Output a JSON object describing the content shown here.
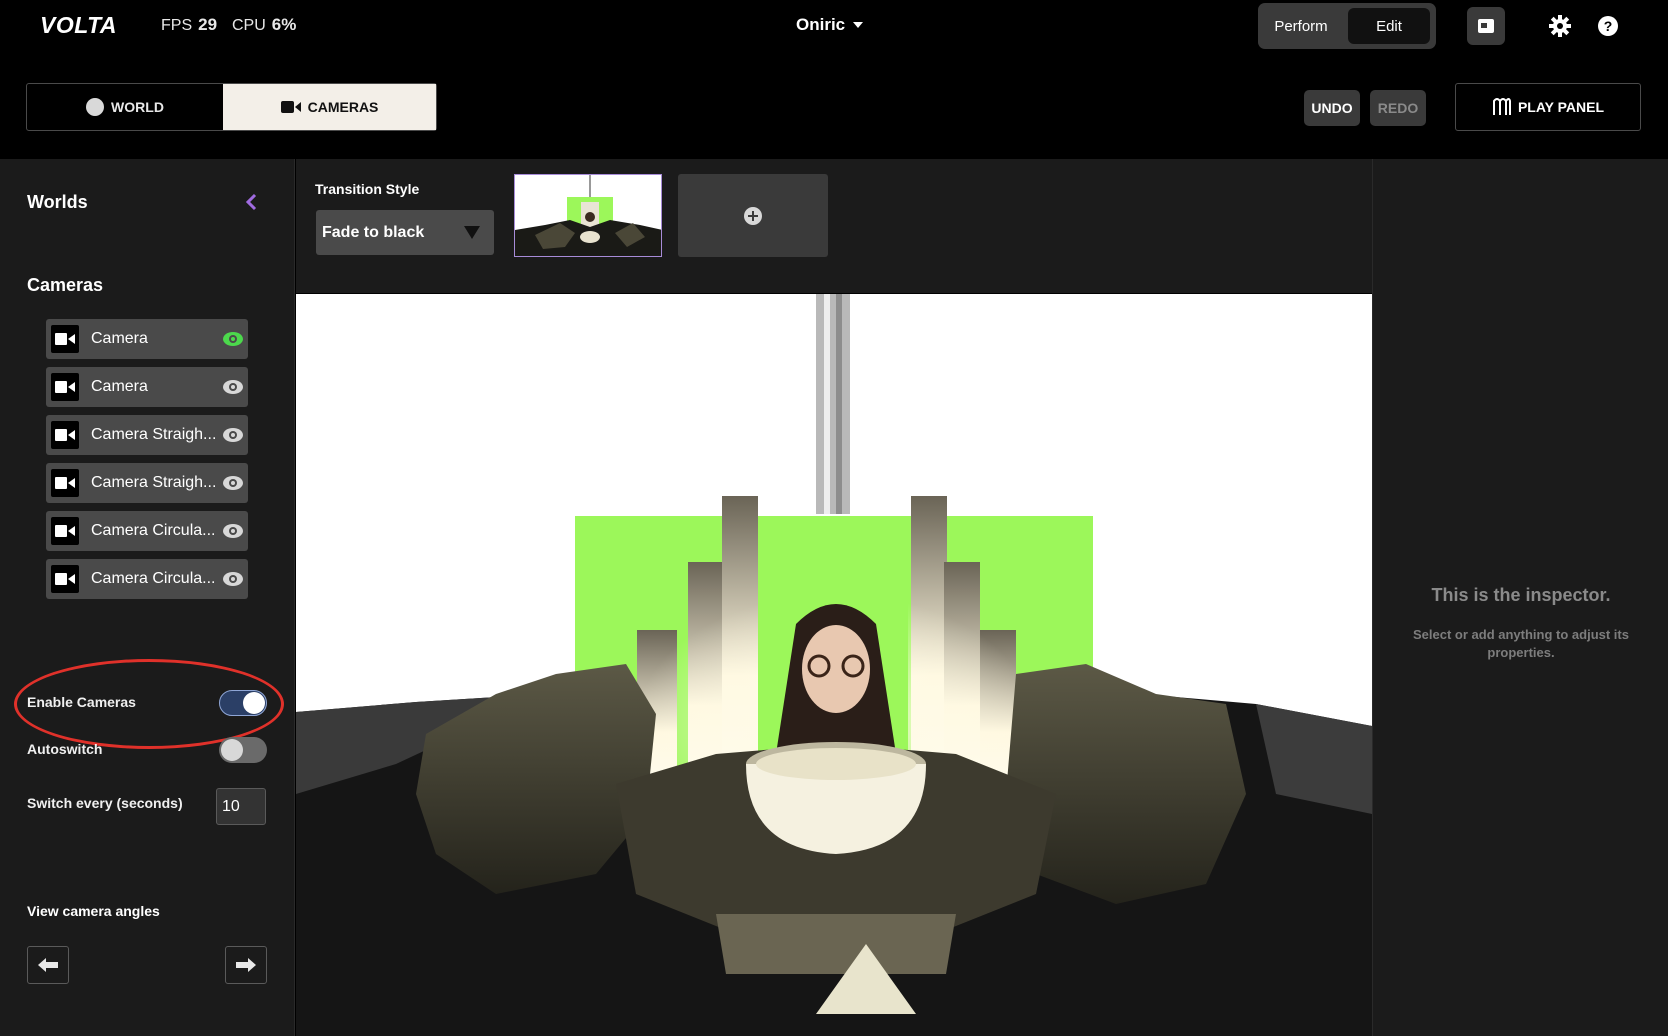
{
  "app": {
    "logo": "VOLTA"
  },
  "stats": {
    "fps_label": "FPS",
    "fps_value": "29",
    "cpu_label": "CPU",
    "cpu_value": "6%"
  },
  "project": {
    "name": "Oniric"
  },
  "mode": {
    "perform": "Perform",
    "edit": "Edit",
    "active": "Edit"
  },
  "tabs": {
    "world": "WORLD",
    "cameras": "CAMERAS",
    "active": "CAMERAS"
  },
  "history": {
    "undo": "UNDO",
    "redo": "REDO"
  },
  "play_panel": "PLAY PANEL",
  "sidebar": {
    "worlds_title": "Worlds",
    "cameras_title": "Cameras",
    "cameras": [
      {
        "label": "Camera",
        "active": true
      },
      {
        "label": "Camera",
        "active": false
      },
      {
        "label": "Camera Straigh...",
        "active": false
      },
      {
        "label": "Camera Straigh...",
        "active": false
      },
      {
        "label": "Camera Circula...",
        "active": false
      },
      {
        "label": "Camera Circula...",
        "active": false
      }
    ],
    "enable_cameras_label": "Enable Cameras",
    "enable_cameras_on": true,
    "autoswitch_label": "Autoswitch",
    "autoswitch_on": false,
    "switch_every_label": "Switch every (seconds)",
    "switch_every_value": "10",
    "view_angles_label": "View camera angles"
  },
  "transition": {
    "label": "Transition Style",
    "value": "Fade to black"
  },
  "inspector": {
    "title": "This is the inspector.",
    "subtitle": "Select or add anything to adjust its properties."
  },
  "colors": {
    "accent_green": "#4cd94c",
    "collapse_purple": "#a06be0",
    "highlight_red": "#e0312a",
    "green_screen": "#9cf75a"
  }
}
